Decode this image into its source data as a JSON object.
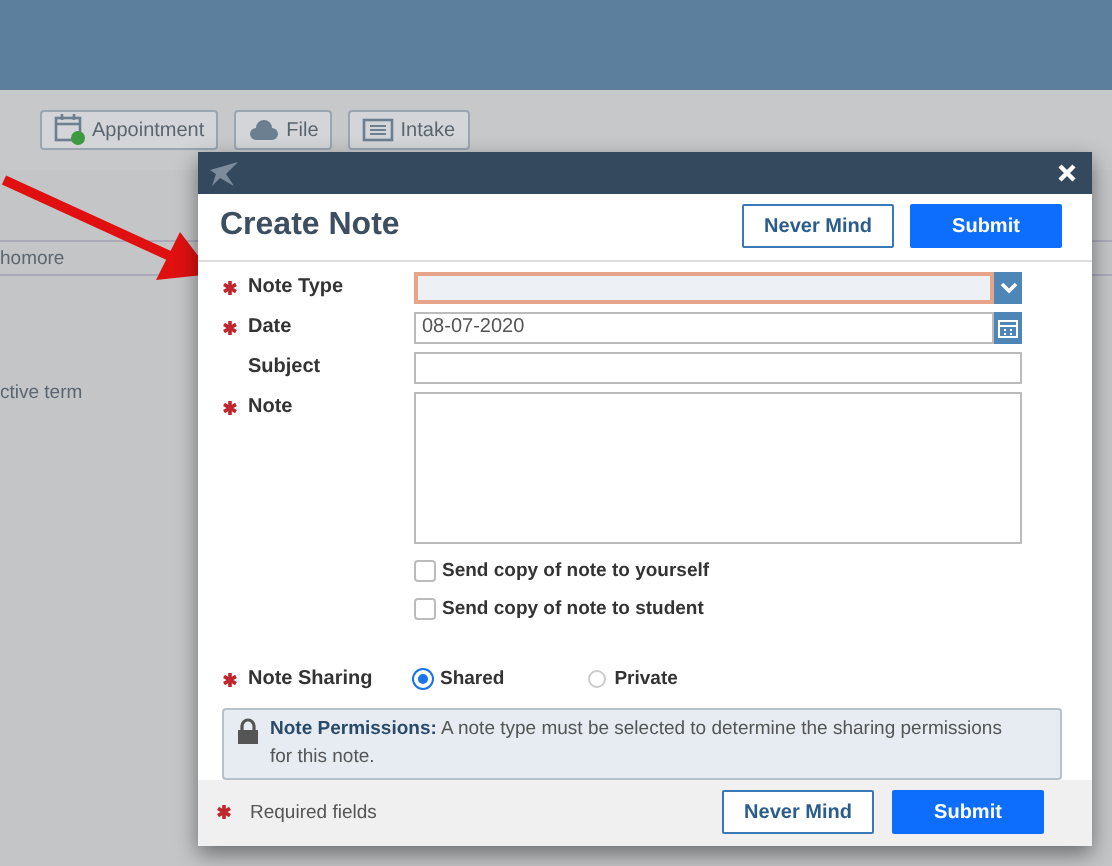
{
  "background": {
    "toolbar_buttons": [
      {
        "label": "Appointment",
        "kind": "calendar"
      },
      {
        "label": "File",
        "kind": "cloud"
      },
      {
        "label": "Intake",
        "kind": "list"
      }
    ],
    "texts": [
      "homore",
      "ctive term"
    ]
  },
  "dialog": {
    "title": "Create Note",
    "header_buttons": [
      {
        "label": "Never Mind",
        "kind": "secondary"
      },
      {
        "label": "Submit",
        "kind": "primary"
      }
    ],
    "fields": [
      {
        "label": "Note Type",
        "required": true,
        "kind": "select",
        "invalid": true
      },
      {
        "label": "Date",
        "required": true,
        "kind": "date",
        "value": "08-07-2020",
        "invalid": false
      },
      {
        "label": "Subject",
        "required": false,
        "kind": "text",
        "invalid": false
      },
      {
        "label": "Note",
        "required": true,
        "kind": "textarea",
        "invalid": false
      }
    ],
    "checkboxes": [
      {
        "label": "Send copy of note to yourself",
        "checked": false
      },
      {
        "label": "Send copy of note to student",
        "checked": false
      }
    ],
    "sharing": {
      "label": "Note Sharing",
      "required": true,
      "options": [
        {
          "label": "Shared",
          "selected": true
        },
        {
          "label": "Private",
          "selected": false
        }
      ]
    },
    "permissions": "**Note Permissions:** A note type must be selected to determine the sharing permissions for this note.",
    "footer": {
      "required_note": "Required fields",
      "buttons": [
        {
          "label": "Never Mind",
          "kind": "secondary"
        },
        {
          "label": "Submit",
          "kind": "primary"
        }
      ]
    }
  }
}
